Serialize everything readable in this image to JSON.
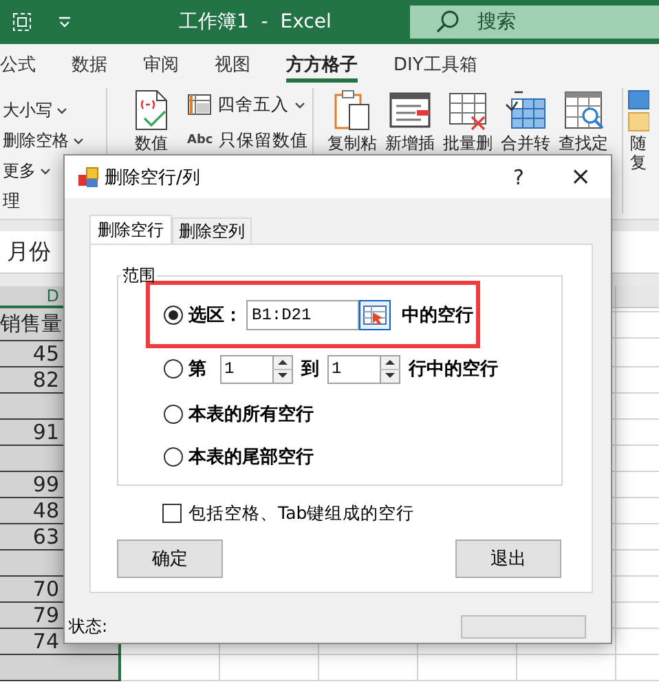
{
  "window": {
    "title": "工作簿1  -  Excel",
    "search": {
      "placeholder": "搜索"
    }
  },
  "ribbon_tabs": [
    {
      "label": "公式",
      "selected": false
    },
    {
      "label": "数据",
      "selected": false
    },
    {
      "label": "审阅",
      "selected": false
    },
    {
      "label": "视图",
      "selected": false
    },
    {
      "label": "方方格子",
      "selected": true
    },
    {
      "label": "DIY工具箱",
      "selected": false
    }
  ],
  "ribbon_groups": [
    {
      "label": "理",
      "items": [
        {
          "kind": "small",
          "label": "大小写",
          "dropdown": true
        },
        {
          "kind": "small",
          "label": "删除空格",
          "dropdown": true
        },
        {
          "kind": "small",
          "label": "更多",
          "dropdown": true
        }
      ]
    },
    {
      "items": [
        {
          "kind": "large",
          "label": "数值"
        },
        {
          "kind": "small",
          "label": "四舍五入",
          "dropdown": true
        },
        {
          "kind": "small",
          "label": "只保留数值",
          "icon_text": "Abc",
          "dropdown": false
        }
      ]
    },
    {
      "items": [
        {
          "kind": "large",
          "label": "复制粘"
        },
        {
          "kind": "large",
          "label": "新增插"
        },
        {
          "kind": "large",
          "label": "批量删"
        },
        {
          "kind": "large",
          "label": "合并转"
        },
        {
          "kind": "large",
          "label": "查找定"
        }
      ]
    },
    {
      "items": [
        {
          "kind": "large",
          "label": "随复"
        }
      ]
    }
  ],
  "formula_bar": {
    "value": "月份"
  },
  "sheet": {
    "column_header": "D",
    "header_cell": "销售量",
    "rows": [
      {
        "value": "45"
      },
      {
        "value": "82"
      },
      {},
      {
        "value": "91"
      },
      {},
      {
        "value": "99"
      },
      {
        "value": "48"
      },
      {
        "value": "63"
      },
      {},
      {
        "value": "70"
      },
      {
        "value": "79"
      },
      {
        "value": "74"
      },
      {}
    ]
  },
  "dialog": {
    "title": "删除空行/列",
    "help": "?",
    "close": "×",
    "tabs": [
      {
        "label": "删除空行",
        "selected": true
      },
      {
        "label": "删除空列",
        "selected": false
      }
    ],
    "group_label": "范围",
    "options": [
      {
        "kind": "range",
        "label": "选区：",
        "value": "B1:D21",
        "suffix": "中的空行",
        "selected": true,
        "highlighted": true
      },
      {
        "kind": "rows",
        "label": "第",
        "from": "1",
        "to_label": "到",
        "to": "1",
        "suffix": "行中的空行",
        "selected": false
      },
      {
        "kind": "plain",
        "label": "本表的所有空行",
        "selected": false
      },
      {
        "kind": "plain",
        "label": "本表的尾部空行",
        "selected": false
      }
    ],
    "checkbox": {
      "label": "包括空格、Tab键组成的空行",
      "checked": false
    },
    "buttons": [
      "确定",
      "退出"
    ],
    "status_label": "状态:"
  }
}
